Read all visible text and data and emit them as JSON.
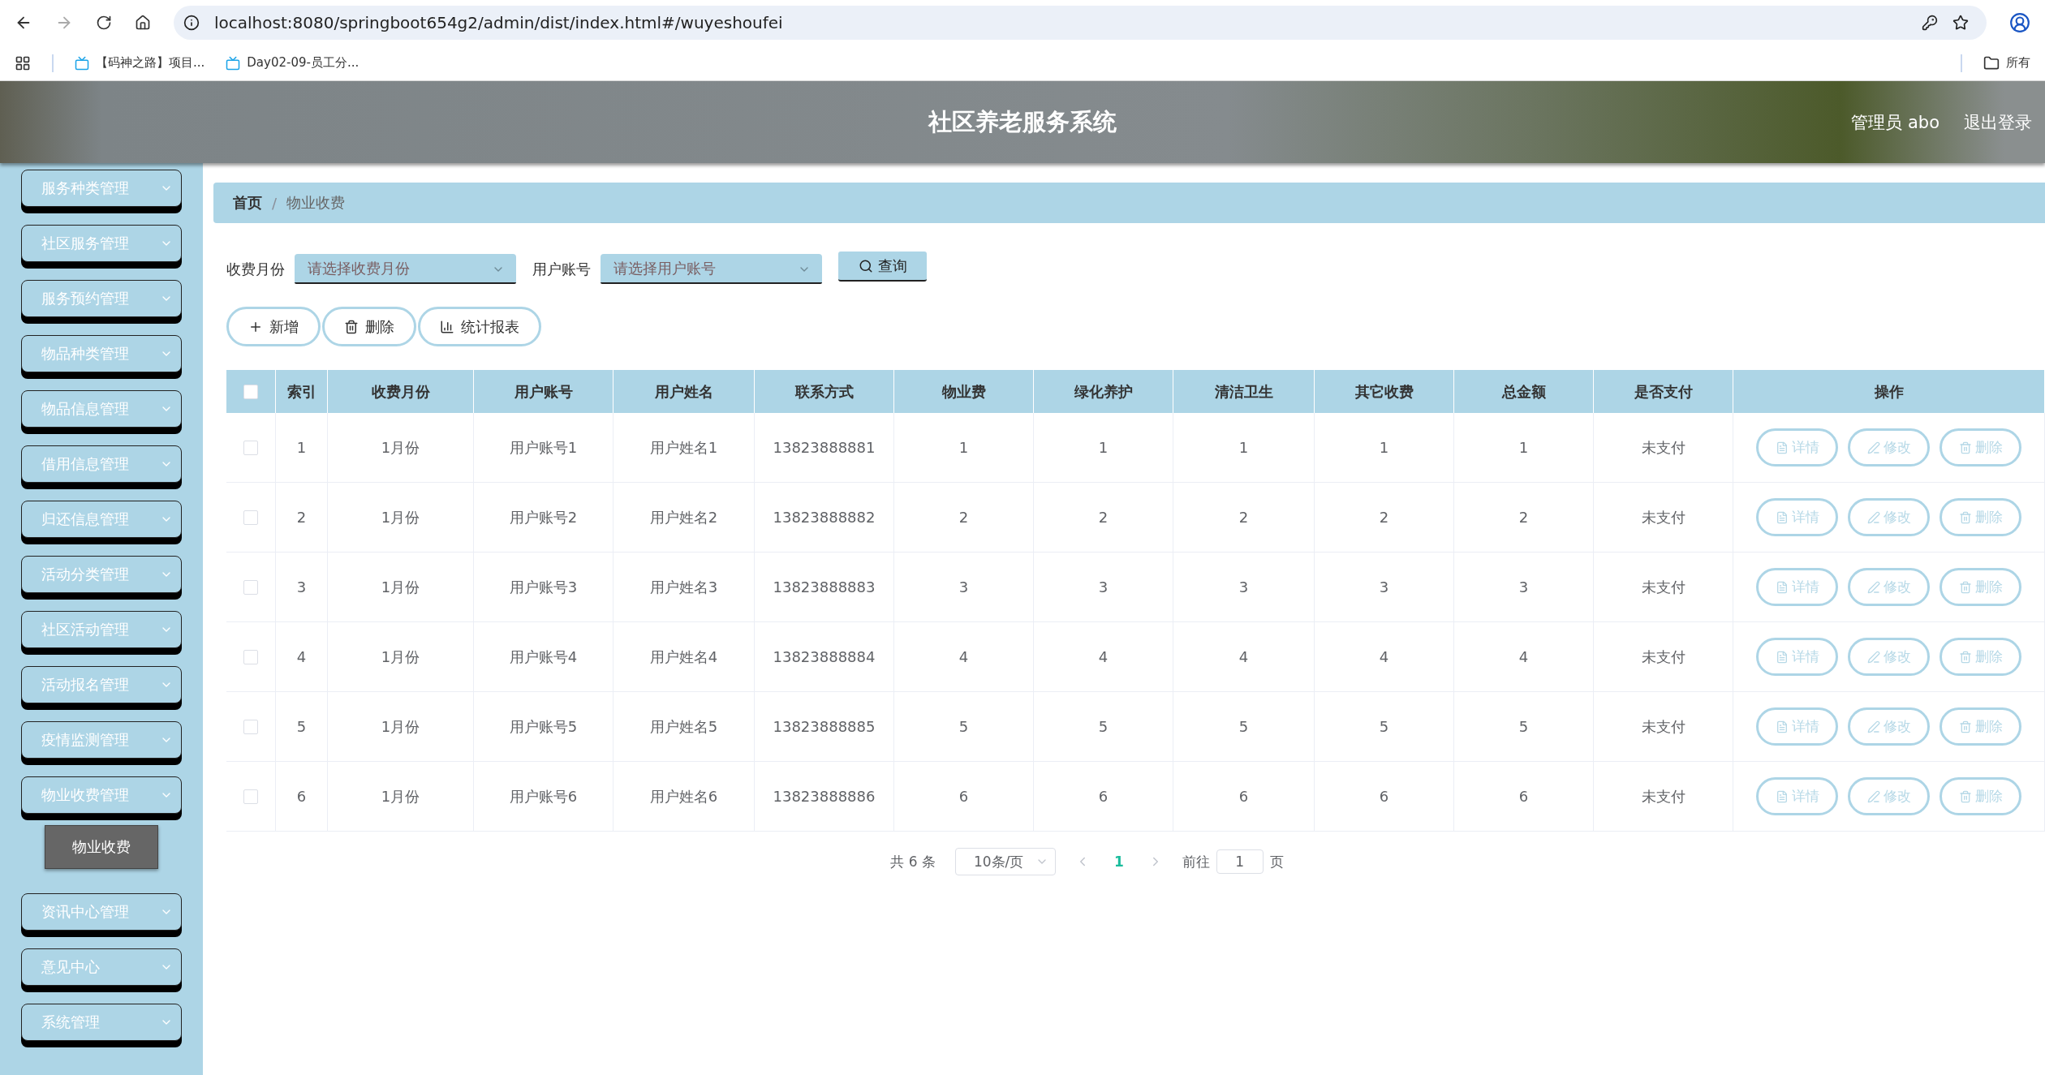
{
  "browser": {
    "url": "localhost:8080/springboot654g2/admin/dist/index.html#/wuyeshoufei",
    "bookmarks": [
      "【码神之路】项目...",
      "Day02-09-员工分..."
    ],
    "folder": "所有"
  },
  "header": {
    "title": "社区养老服务系统",
    "user": "管理员 abo",
    "logout": "退出登录"
  },
  "sidebar": {
    "items": [
      {
        "label": "服务种类管理"
      },
      {
        "label": "社区服务管理"
      },
      {
        "label": "服务预约管理"
      },
      {
        "label": "物品种类管理"
      },
      {
        "label": "物品信息管理"
      },
      {
        "label": "借用信息管理"
      },
      {
        "label": "归还信息管理"
      },
      {
        "label": "活动分类管理"
      },
      {
        "label": "社区活动管理"
      },
      {
        "label": "活动报名管理"
      },
      {
        "label": "疫情监测管理"
      },
      {
        "label": "物业收费管理",
        "children": [
          {
            "label": "物业收费",
            "selected": true
          }
        ]
      },
      {
        "label": "资讯中心管理"
      },
      {
        "label": "意见中心"
      },
      {
        "label": "系统管理"
      }
    ]
  },
  "breadcrumb": {
    "items": [
      "首页",
      "物业收费"
    ],
    "separator": "/"
  },
  "search": {
    "fields": [
      {
        "label": "收费月份",
        "placeholder": "请选择收费月份"
      },
      {
        "label": "用户账号",
        "placeholder": "请选择用户账号"
      }
    ],
    "button": "查询"
  },
  "toolbar": [
    {
      "kind": "add",
      "label": "新增"
    },
    {
      "kind": "delete",
      "label": "删除"
    },
    {
      "kind": "chart",
      "label": "统计报表"
    }
  ],
  "table": {
    "all_checked": false,
    "columns": [
      "索引",
      "收费月份",
      "用户账号",
      "用户姓名",
      "联系方式",
      "物业费",
      "绿化养护",
      "清洁卫生",
      "其它收费",
      "总金额",
      "是否支付",
      "操作"
    ],
    "rows": [
      {
        "checked": false,
        "cells": [
          "1",
          "1月份",
          "用户账号1",
          "用户姓名1",
          "13823888881",
          "1",
          "1",
          "1",
          "1",
          "1",
          "未支付"
        ],
        "actions": [
          {
            "kind": "detail",
            "label": "详情"
          },
          {
            "kind": "edit",
            "label": "修改"
          },
          {
            "kind": "delete",
            "label": "删除"
          }
        ]
      },
      {
        "checked": false,
        "cells": [
          "2",
          "1月份",
          "用户账号2",
          "用户姓名2",
          "13823888882",
          "2",
          "2",
          "2",
          "2",
          "2",
          "未支付"
        ],
        "actions": [
          {
            "kind": "detail",
            "label": "详情"
          },
          {
            "kind": "edit",
            "label": "修改"
          },
          {
            "kind": "delete",
            "label": "删除"
          }
        ]
      },
      {
        "checked": false,
        "cells": [
          "3",
          "1月份",
          "用户账号3",
          "用户姓名3",
          "13823888883",
          "3",
          "3",
          "3",
          "3",
          "3",
          "未支付"
        ],
        "actions": [
          {
            "kind": "detail",
            "label": "详情"
          },
          {
            "kind": "edit",
            "label": "修改"
          },
          {
            "kind": "delete",
            "label": "删除"
          }
        ]
      },
      {
        "checked": false,
        "cells": [
          "4",
          "1月份",
          "用户账号4",
          "用户姓名4",
          "13823888884",
          "4",
          "4",
          "4",
          "4",
          "4",
          "未支付"
        ],
        "actions": [
          {
            "kind": "detail",
            "label": "详情"
          },
          {
            "kind": "edit",
            "label": "修改"
          },
          {
            "kind": "delete",
            "label": "删除"
          }
        ]
      },
      {
        "checked": false,
        "cells": [
          "5",
          "1月份",
          "用户账号5",
          "用户姓名5",
          "13823888885",
          "5",
          "5",
          "5",
          "5",
          "5",
          "未支付"
        ],
        "actions": [
          {
            "kind": "detail",
            "label": "详情"
          },
          {
            "kind": "edit",
            "label": "修改"
          },
          {
            "kind": "delete",
            "label": "删除"
          }
        ]
      },
      {
        "checked": false,
        "cells": [
          "6",
          "1月份",
          "用户账号6",
          "用户姓名6",
          "13823888886",
          "6",
          "6",
          "6",
          "6",
          "6",
          "未支付"
        ],
        "actions": [
          {
            "kind": "detail",
            "label": "详情"
          },
          {
            "kind": "edit",
            "label": "修改"
          },
          {
            "kind": "delete",
            "label": "删除"
          }
        ]
      }
    ]
  },
  "pagination": {
    "total": "共 6 条",
    "page_size": "10条/页",
    "pages": [
      {
        "label": "1",
        "selected": true
      }
    ],
    "goto_label": "前往",
    "goto_value": "1",
    "goto_suffix": "页"
  }
}
